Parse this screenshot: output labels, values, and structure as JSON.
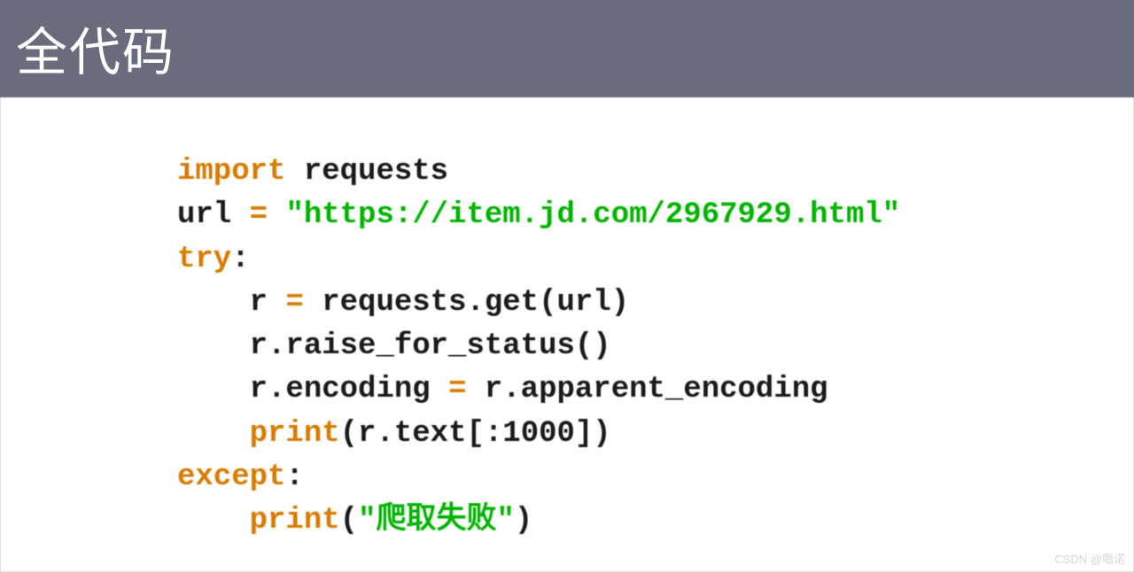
{
  "header": {
    "title": "全代码"
  },
  "code": {
    "lines": [
      {
        "indent": 0,
        "segments": [
          {
            "cls": "kw",
            "text": "import"
          },
          {
            "cls": "plain",
            "text": " requests"
          }
        ]
      },
      {
        "indent": 0,
        "segments": [
          {
            "cls": "plain",
            "text": "url "
          },
          {
            "cls": "kw",
            "text": "="
          },
          {
            "cls": "plain",
            "text": " "
          },
          {
            "cls": "str",
            "text": "\"https://item.jd.com/2967929.html\""
          }
        ]
      },
      {
        "indent": 0,
        "segments": [
          {
            "cls": "kw",
            "text": "try"
          },
          {
            "cls": "plain",
            "text": ":"
          }
        ]
      },
      {
        "indent": 1,
        "segments": [
          {
            "cls": "plain",
            "text": "r "
          },
          {
            "cls": "kw",
            "text": "="
          },
          {
            "cls": "plain",
            "text": " requests.get(url)"
          }
        ]
      },
      {
        "indent": 1,
        "segments": [
          {
            "cls": "plain",
            "text": "r.raise_for_status()"
          }
        ]
      },
      {
        "indent": 1,
        "segments": [
          {
            "cls": "plain",
            "text": "r.encoding "
          },
          {
            "cls": "kw",
            "text": "="
          },
          {
            "cls": "plain",
            "text": " r.apparent_encoding"
          }
        ]
      },
      {
        "indent": 1,
        "segments": [
          {
            "cls": "kw",
            "text": "print"
          },
          {
            "cls": "plain",
            "text": "(r.text[:1000])"
          }
        ]
      },
      {
        "indent": 0,
        "segments": [
          {
            "cls": "kw",
            "text": "except"
          },
          {
            "cls": "plain",
            "text": ":"
          }
        ]
      },
      {
        "indent": 1,
        "segments": [
          {
            "cls": "kw",
            "text": "print"
          },
          {
            "cls": "plain",
            "text": "("
          },
          {
            "cls": "str",
            "text": "\"爬取失败\""
          },
          {
            "cls": "plain",
            "text": ")"
          }
        ]
      }
    ]
  },
  "watermark": "CSDN @嗯诺"
}
